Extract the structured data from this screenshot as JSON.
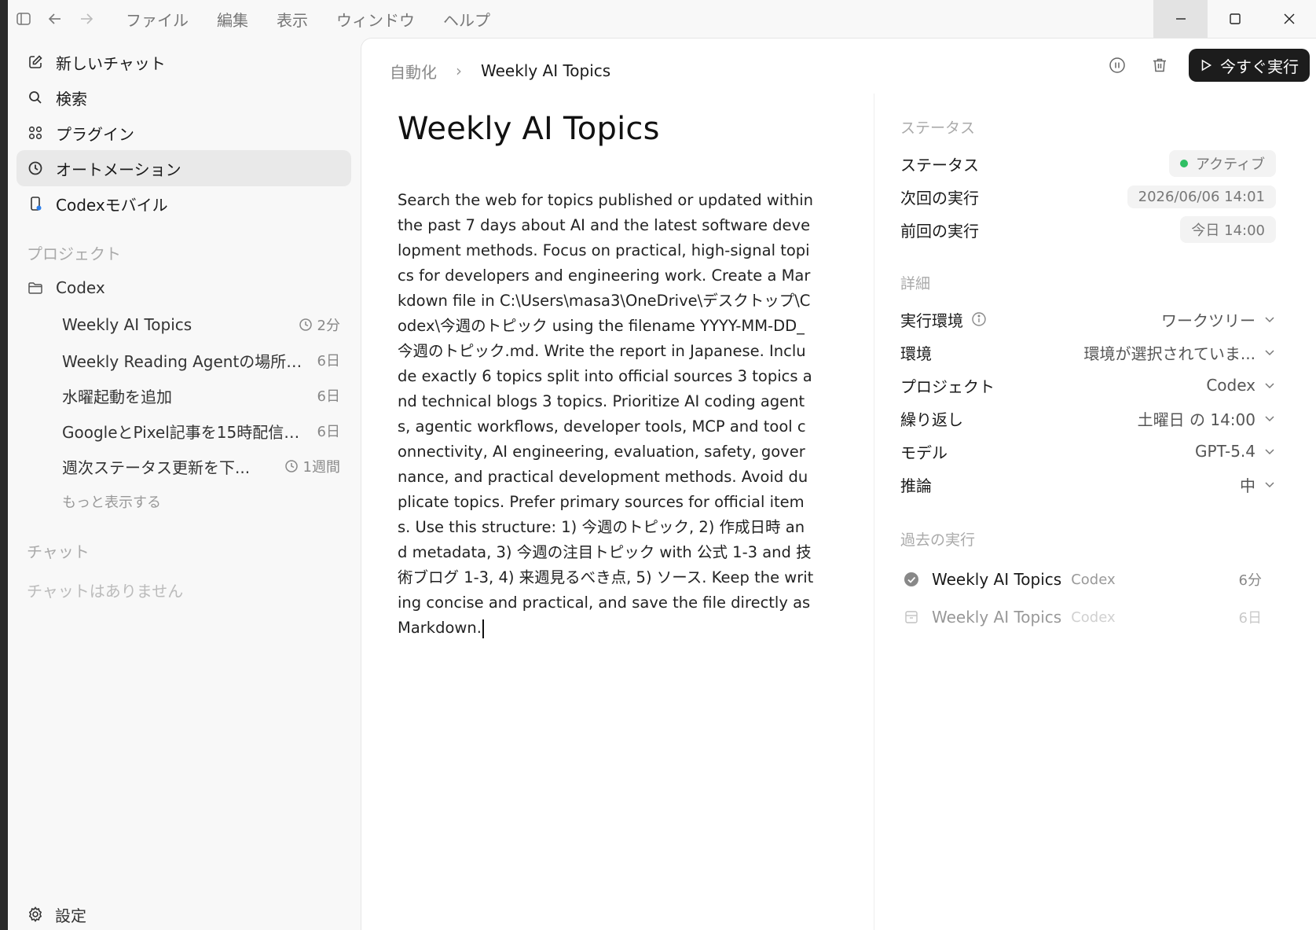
{
  "menu": [
    "ファイル",
    "編集",
    "表示",
    "ウィンドウ",
    "ヘルプ"
  ],
  "sidebar": {
    "nav": [
      "新しいチャット",
      "検索",
      "プラグイン",
      "オートメーション",
      "Codexモバイル"
    ],
    "projects_title": "プロジェクト",
    "project_name": "Codex",
    "threads": [
      {
        "label": "Weekly AI Topics",
        "meta": "2分"
      },
      {
        "label": "Weekly Reading Agentの場所を...",
        "meta": "6日"
      },
      {
        "label": "水曜起動を追加",
        "meta": "6日"
      },
      {
        "label": "GoogleとPixel記事を15時配信に...",
        "meta": "6日"
      },
      {
        "label": "週次ステータス更新を下...",
        "meta": "1週間"
      }
    ],
    "more": "もっと表示する",
    "chat_title": "チャット",
    "chat_empty": "チャットはありません",
    "settings": "設定"
  },
  "breadcrumb": {
    "root": "自動化",
    "sep": "›",
    "current": "Weekly AI Topics"
  },
  "actions": {
    "run_now": "今すぐ実行"
  },
  "page": {
    "title": "Weekly AI Topics",
    "prompt": "Search the web for topics published or updated within the past 7 days about AI and the latest software development methods. Focus on practical, high-signal topics for developers and engineering work. Create a Markdown file in C:\\Users\\masa3\\OneDrive\\デスクトップ\\Codex\\今週のトピック using the filename YYYY-MM-DD_今週のトピック.md. Write the report in Japanese. Include exactly 6 topics split into official sources 3 topics and technical blogs 3 topics. Prioritize AI coding agents, agentic workflows, developer tools, MCP and tool connectivity, AI engineering, evaluation, safety, governance, and practical development methods. Avoid duplicate topics. Prefer primary sources for official items. Use this structure: 1) 今週のトピック, 2) 作成日時 and metadata, 3) 今週の注目トピック with 公式 1-3 and 技術ブログ 1-3, 4) 来週見るべき点, 5) ソース. Keep the writing concise and practical, and save the file directly as Markdown."
  },
  "panel": {
    "status_title": "ステータス",
    "status_label": "ステータス",
    "status_value": "アクティブ",
    "status_color": "#2fbf63",
    "next_label": "次回の実行",
    "next_value": "2026/06/06 14:01",
    "prev_label": "前回の実行",
    "prev_value": "今日 14:00",
    "details_title": "詳細",
    "details": [
      {
        "label": "実行環境",
        "value": "ワークツリー"
      },
      {
        "label": "環境",
        "value": "環境が選択されていま..."
      },
      {
        "label": "プロジェクト",
        "value": "Codex"
      },
      {
        "label": "繰り返し",
        "value": "土曜日 の 14:00"
      },
      {
        "label": "モデル",
        "value": "GPT-5.4"
      },
      {
        "label": "推論",
        "value": "中"
      }
    ],
    "history_title": "過去の実行",
    "history": [
      {
        "title": "Weekly AI Topics",
        "project": "Codex",
        "time": "6分"
      },
      {
        "title": "Weekly AI Topics",
        "project": "Codex",
        "time": "6日"
      }
    ]
  }
}
